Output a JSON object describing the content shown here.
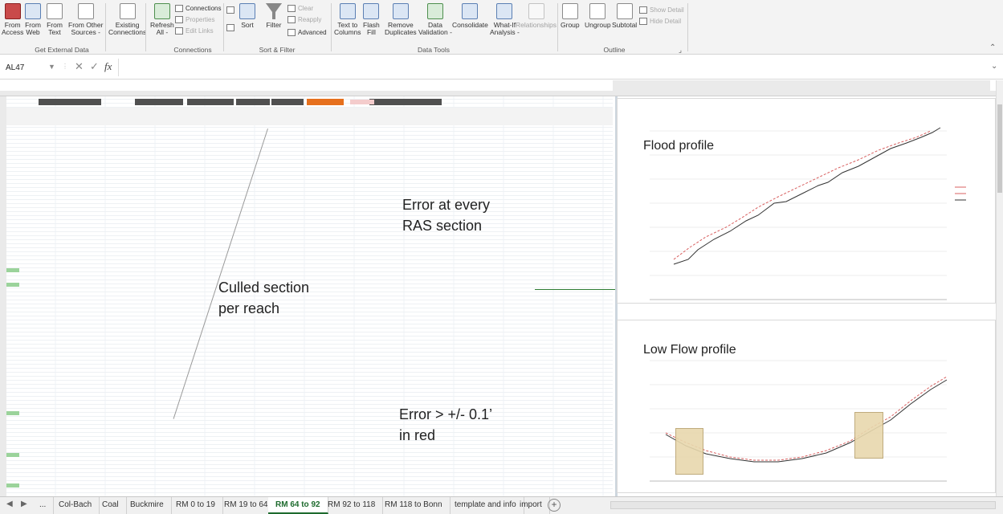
{
  "ribbon": {
    "buttons": [
      {
        "id": "from-access",
        "l1": "From",
        "l2": "Access"
      },
      {
        "id": "from-web",
        "l1": "From",
        "l2": "Web"
      },
      {
        "id": "from-text",
        "l1": "From",
        "l2": "Text"
      },
      {
        "id": "from-other",
        "l1": "From Other",
        "l2": "Sources -"
      },
      {
        "id": "existing-connections",
        "l1": "Existing",
        "l2": "Connections"
      },
      {
        "id": "refresh-all",
        "l1": "Refresh",
        "l2": "All -"
      },
      {
        "id": "sort",
        "l1": "Sort",
        "l2": ""
      },
      {
        "id": "filter",
        "l1": "Filter",
        "l2": ""
      },
      {
        "id": "text-to-columns",
        "l1": "Text to",
        "l2": "Columns"
      },
      {
        "id": "flash-fill",
        "l1": "Flash",
        "l2": "Fill"
      },
      {
        "id": "remove-duplicates",
        "l1": "Remove",
        "l2": "Duplicates"
      },
      {
        "id": "data-validation",
        "l1": "Data",
        "l2": "Validation -"
      },
      {
        "id": "consolidate",
        "l1": "Consolidate",
        "l2": ""
      },
      {
        "id": "what-if",
        "l1": "What-If",
        "l2": "Analysis -"
      },
      {
        "id": "relationships",
        "l1": "Relationships",
        "l2": ""
      },
      {
        "id": "group",
        "l1": "Group",
        "l2": ""
      },
      {
        "id": "ungroup",
        "l1": "Ungroup",
        "l2": ""
      },
      {
        "id": "subtotal",
        "l1": "Subtotal",
        "l2": ""
      }
    ],
    "small": {
      "connections": "Connections",
      "properties": "Properties",
      "edit_links": "Edit Links",
      "clear": "Clear",
      "reapply": "Reapply",
      "advanced": "Advanced",
      "show_detail": "Show Detail",
      "hide_detail": "Hide Detail"
    },
    "groups": {
      "get_external": "Get External Data",
      "connections": "Connections",
      "sort_filter": "Sort & Filter",
      "data_tools": "Data Tools",
      "outline": "Outline"
    }
  },
  "formula_bar": {
    "name_box": "AL47",
    "cancel": "✕",
    "enter": "✓",
    "fx": "fx",
    "value": ""
  },
  "annotations": {
    "error_every": "Error at every\nRAS section",
    "culled": "Culled section\nper reach",
    "error_red": "Error > +/- 0.1’\nin red"
  },
  "charts": {
    "flood_title": "Flood profile",
    "lowflow_title": "Low Flow profile"
  },
  "tabs": {
    "nav_prev": "◀",
    "nav_next": "▶",
    "ellipsis": "...",
    "items": [
      "Col-Bach",
      "Coal",
      "Buckmire",
      "RM 0 to 19",
      "RM 19 to 64",
      "RM 64 to 92",
      "RM 92 to 118",
      "RM 118 to Bonn",
      "template and info",
      "import"
    ],
    "active": "RM 64 to 92",
    "add": "+"
  },
  "colors": {
    "active_tab": "#1e6b2e",
    "header_dark": "#404040",
    "header_orange": "#e6701d",
    "series_line": "#333333",
    "series_dash": "#d86060"
  }
}
